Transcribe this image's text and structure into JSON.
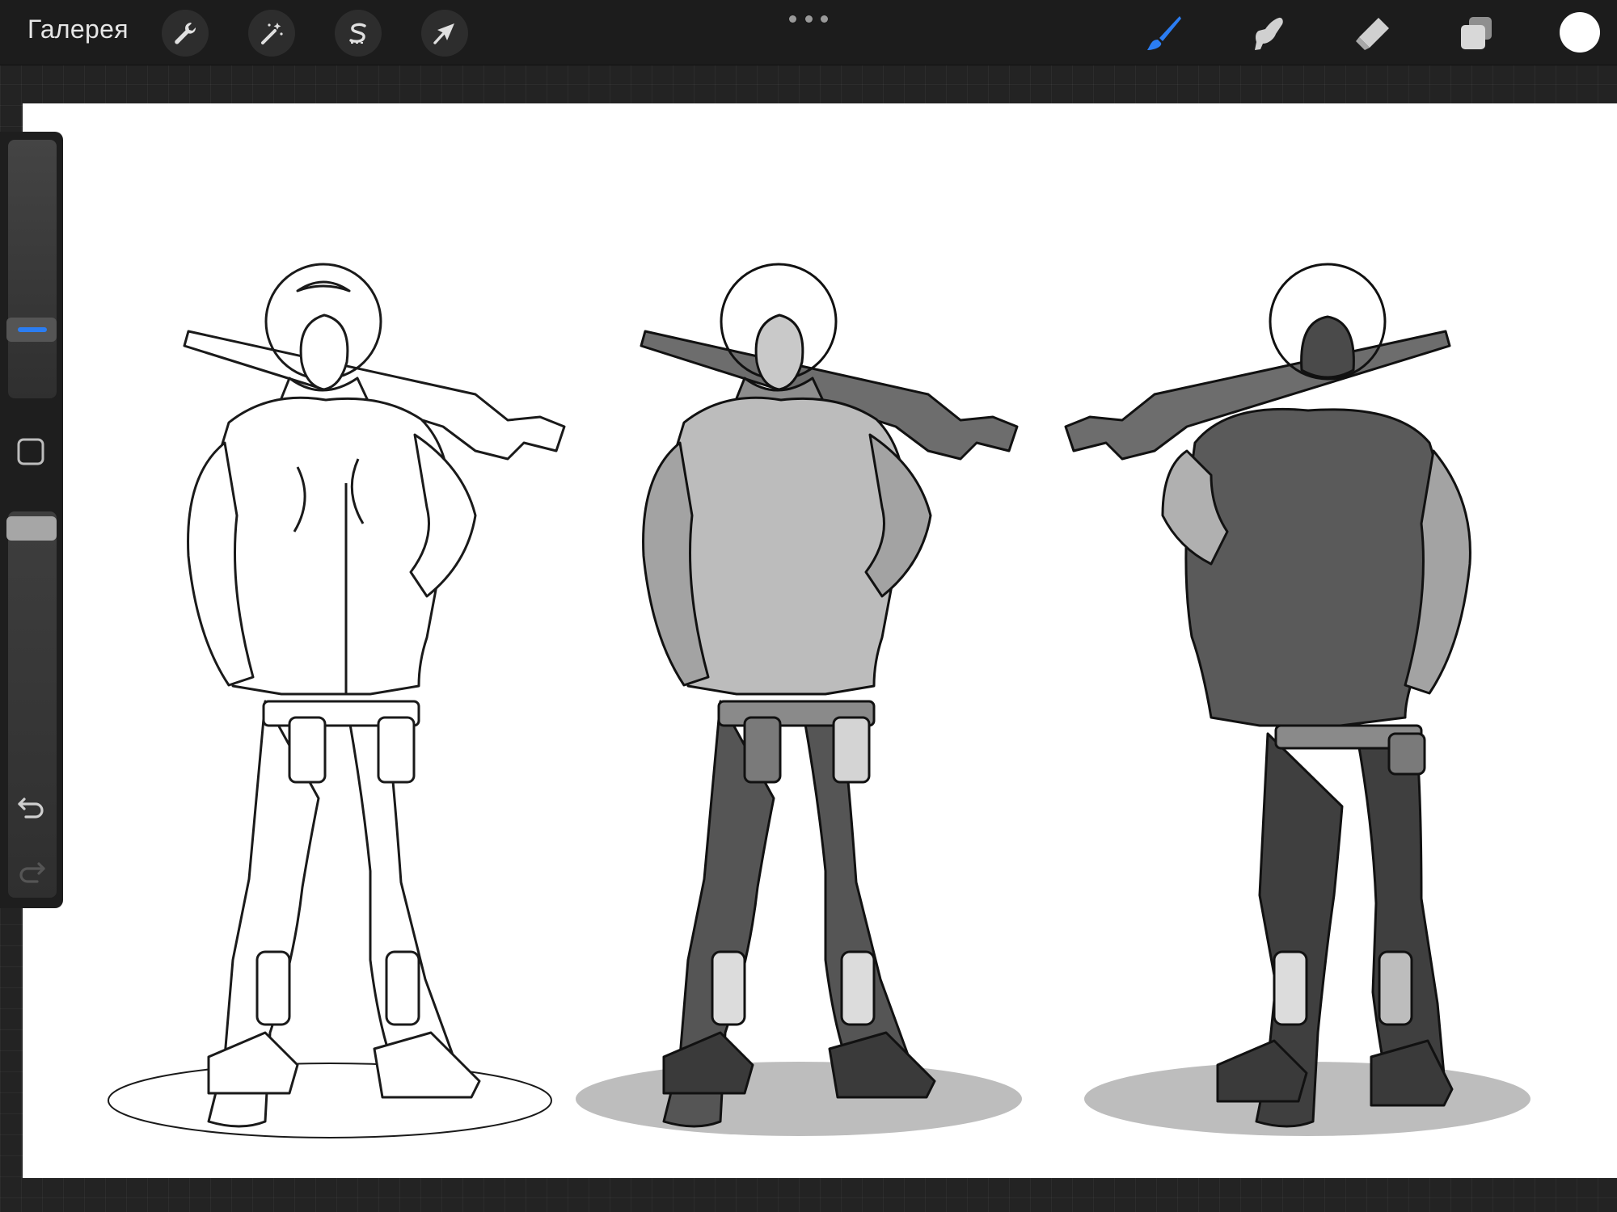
{
  "topbar": {
    "gallery_label": "Галерея",
    "left_tools": [
      {
        "name": "actions",
        "icon": "wrench-icon"
      },
      {
        "name": "adjustments",
        "icon": "magic-wand-icon"
      },
      {
        "name": "selection",
        "icon": "selection-s-icon"
      },
      {
        "name": "transform",
        "icon": "arrow-cursor-icon"
      }
    ],
    "more_icon": "more-dots-icon",
    "right_tools": [
      {
        "name": "brush",
        "icon": "brush-icon",
        "active": true
      },
      {
        "name": "smudge",
        "icon": "smudge-finger-icon",
        "active": false
      },
      {
        "name": "eraser",
        "icon": "eraser-icon",
        "active": false
      },
      {
        "name": "layers",
        "icon": "layers-icon",
        "active": false
      }
    ],
    "current_color": "#ffffff"
  },
  "sidebar": {
    "brush_size_icon": "size-slider-icon",
    "modify_icon": "square-modify-icon",
    "opacity_icon": "opacity-slider-icon",
    "undo_icon": "undo-icon",
    "redo_icon": "redo-icon",
    "redo_enabled": false
  },
  "canvas": {
    "background": "#ffffff",
    "artwork": [
      "astronaut-lineart-front",
      "astronaut-shaded-front",
      "astronaut-shaded-back"
    ]
  },
  "colors": {
    "accent": "#2b7df2",
    "topbar": "#1c1c1c",
    "background": "#232323"
  }
}
